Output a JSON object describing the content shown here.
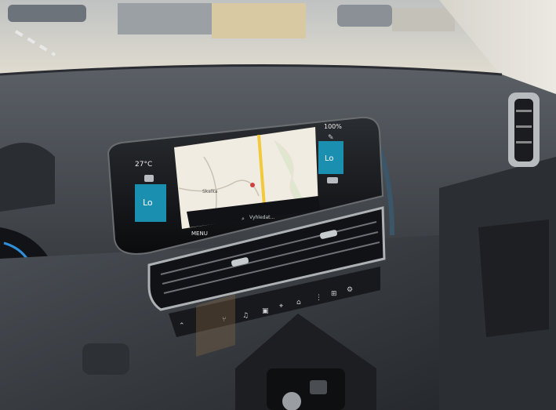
{
  "photo": {
    "subject": "car-dashboard-infotainment",
    "colors": {
      "dash": "#3a3f45",
      "screen_frame": "#0b0d10",
      "climate_tile": "#1b8fb0",
      "map_bg": "#f1ece2",
      "windshield": "#cfd2d3"
    }
  },
  "climate": {
    "left": {
      "temp": "27°C",
      "level": "Lo"
    },
    "right": {
      "temp": "100%",
      "level": "Lo"
    }
  },
  "nav": {
    "menu_label": "MENU",
    "search_text": "Vyhledat...",
    "map_label": "Skalka"
  }
}
